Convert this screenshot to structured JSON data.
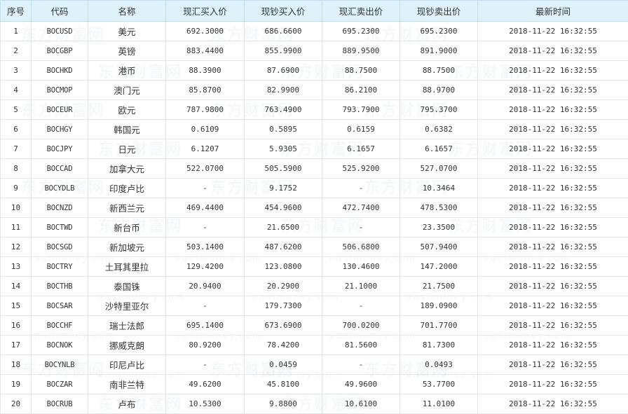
{
  "table": {
    "headers": {
      "index": "序号",
      "code": "代码",
      "name": "名称",
      "spot_buy": "现汇买入价",
      "cash_buy": "现钞买入价",
      "spot_sell": "现汇卖出价",
      "cash_sell": "现钞卖出价",
      "updated": "最新时间"
    },
    "rows": [
      {
        "index": "1",
        "code": "BOCUSD",
        "name": "美元",
        "spot_buy": "692.3000",
        "cash_buy": "686.6600",
        "spot_sell": "695.2300",
        "cash_sell": "695.2300",
        "updated": "2018-11-22 16:32:55"
      },
      {
        "index": "2",
        "code": "BOCGBP",
        "name": "英镑",
        "spot_buy": "883.4400",
        "cash_buy": "855.9900",
        "spot_sell": "889.9500",
        "cash_sell": "891.9000",
        "updated": "2018-11-22 16:32:55"
      },
      {
        "index": "3",
        "code": "BOCHKD",
        "name": "港币",
        "spot_buy": "88.3900",
        "cash_buy": "87.6900",
        "spot_sell": "88.7500",
        "cash_sell": "88.7500",
        "updated": "2018-11-22 16:32:55"
      },
      {
        "index": "4",
        "code": "BOCMOP",
        "name": "澳门元",
        "spot_buy": "85.8700",
        "cash_buy": "82.9900",
        "spot_sell": "86.2100",
        "cash_sell": "88.9700",
        "updated": "2018-11-22 16:32:55"
      },
      {
        "index": "5",
        "code": "BOCEUR",
        "name": "欧元",
        "spot_buy": "787.9800",
        "cash_buy": "763.4900",
        "spot_sell": "793.7900",
        "cash_sell": "795.3700",
        "updated": "2018-11-22 16:32:55"
      },
      {
        "index": "6",
        "code": "BOCHGY",
        "name": "韩国元",
        "spot_buy": "0.6109",
        "cash_buy": "0.5895",
        "spot_sell": "0.6159",
        "cash_sell": "0.6382",
        "updated": "2018-11-22 16:32:55"
      },
      {
        "index": "7",
        "code": "BOCJPY",
        "name": "日元",
        "spot_buy": "6.1207",
        "cash_buy": "5.9305",
        "spot_sell": "6.1657",
        "cash_sell": "6.1657",
        "updated": "2018-11-22 16:32:55"
      },
      {
        "index": "8",
        "code": "BOCCAD",
        "name": "加拿大元",
        "spot_buy": "522.0700",
        "cash_buy": "505.5900",
        "spot_sell": "525.9200",
        "cash_sell": "527.0700",
        "updated": "2018-11-22 16:32:55"
      },
      {
        "index": "9",
        "code": "BOCYDLB",
        "name": "印度卢比",
        "spot_buy": "-",
        "cash_buy": "9.1752",
        "spot_sell": "-",
        "cash_sell": "10.3464",
        "updated": "2018-11-22 16:32:55"
      },
      {
        "index": "10",
        "code": "BOCNZD",
        "name": "新西兰元",
        "spot_buy": "469.4400",
        "cash_buy": "454.9600",
        "spot_sell": "472.7400",
        "cash_sell": "478.5300",
        "updated": "2018-11-22 16:32:55"
      },
      {
        "index": "11",
        "code": "BOCTWD",
        "name": "新台币",
        "spot_buy": "-",
        "cash_buy": "21.6500",
        "spot_sell": "-",
        "cash_sell": "23.3500",
        "updated": "2018-11-22 16:32:55"
      },
      {
        "index": "12",
        "code": "BOCSGD",
        "name": "新加坡元",
        "spot_buy": "503.1400",
        "cash_buy": "487.6200",
        "spot_sell": "506.6800",
        "cash_sell": "507.9400",
        "updated": "2018-11-22 16:32:55"
      },
      {
        "index": "13",
        "code": "BOCTRY",
        "name": "土耳其里拉",
        "spot_buy": "129.4200",
        "cash_buy": "123.0800",
        "spot_sell": "130.4600",
        "cash_sell": "147.2000",
        "updated": "2018-11-22 16:32:55"
      },
      {
        "index": "14",
        "code": "BOCTHB",
        "name": "泰国铢",
        "spot_buy": "20.9400",
        "cash_buy": "20.2900",
        "spot_sell": "21.1000",
        "cash_sell": "21.7500",
        "updated": "2018-11-22 16:32:55"
      },
      {
        "index": "15",
        "code": "BOCSAR",
        "name": "沙特里亚尔",
        "spot_buy": "-",
        "cash_buy": "179.7300",
        "spot_sell": "-",
        "cash_sell": "189.0900",
        "updated": "2018-11-22 16:32:55"
      },
      {
        "index": "16",
        "code": "BOCCHF",
        "name": "瑞士法郎",
        "spot_buy": "695.1400",
        "cash_buy": "673.6900",
        "spot_sell": "700.0200",
        "cash_sell": "701.7700",
        "updated": "2018-11-22 16:32:55"
      },
      {
        "index": "17",
        "code": "BOCNOK",
        "name": "挪威克朗",
        "spot_buy": "80.9200",
        "cash_buy": "78.4200",
        "spot_sell": "81.5600",
        "cash_sell": "81.7300",
        "updated": "2018-11-22 16:32:55"
      },
      {
        "index": "18",
        "code": "BOCYNLB",
        "name": "印尼卢比",
        "spot_buy": "-",
        "cash_buy": "0.0459",
        "spot_sell": "-",
        "cash_sell": "0.0493",
        "updated": "2018-11-22 16:32:55"
      },
      {
        "index": "19",
        "code": "BOCZAR",
        "name": "南非兰特",
        "spot_buy": "49.6200",
        "cash_buy": "45.8100",
        "spot_sell": "49.9600",
        "cash_sell": "53.7700",
        "updated": "2018-11-22 16:32:55"
      },
      {
        "index": "20",
        "code": "BOCRUB",
        "name": "卢布",
        "spot_buy": "10.5300",
        "cash_buy": "9.8800",
        "spot_sell": "10.6100",
        "cash_sell": "11.0100",
        "updated": "2018-11-22 16:32:55"
      }
    ]
  },
  "watermark": {
    "brand": "东方财富网",
    "url": "eastmoney.com"
  },
  "colors": {
    "header_bg": "#dff2fc",
    "text": "#333333",
    "grid": "#e6e6e6"
  }
}
